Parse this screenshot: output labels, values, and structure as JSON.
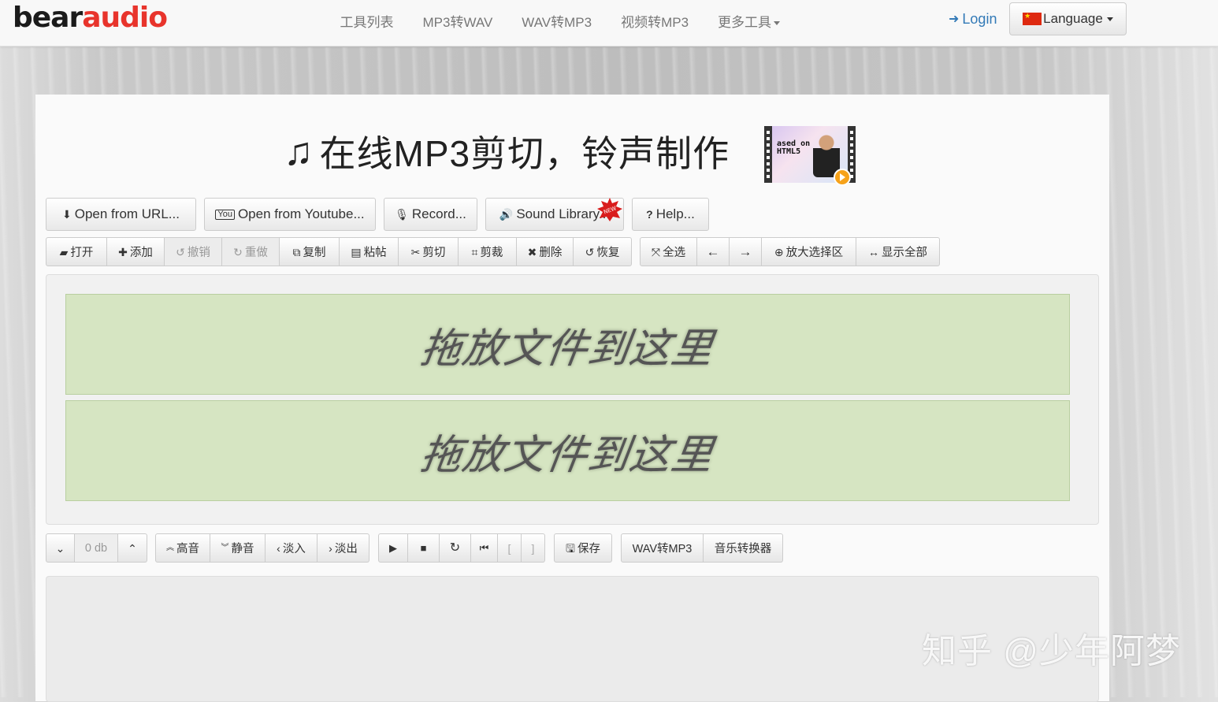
{
  "brand": {
    "part1": "bear",
    "part2": "audio"
  },
  "nav": {
    "items": [
      "工具列表",
      "MP3转WAV",
      "WAV转MP3",
      "视频转MP3",
      "更多工具"
    ],
    "login": "Login",
    "language": "Language"
  },
  "title": "在线MP3剪切，铃声制作",
  "video_thumb_text": "ased on\nHTML5",
  "toolbar1": [
    {
      "label": "Open from URL...",
      "icon": "download-icon"
    },
    {
      "label": "Open from Youtube...",
      "icon": "youtube-icon"
    },
    {
      "label": "Record...",
      "icon": "microphone-icon"
    },
    {
      "label": "Sound Library...",
      "icon": "volume-icon"
    },
    {
      "label": "Help...",
      "icon": "question-icon"
    }
  ],
  "toolbar2": {
    "edit": [
      {
        "label": "打开",
        "icon": "folder-open-icon",
        "glyph": "▰"
      },
      {
        "label": "添加",
        "icon": "plus-icon",
        "glyph": "✚"
      },
      {
        "label": "撤销",
        "icon": "undo-icon",
        "glyph": "↺",
        "disabled": true
      },
      {
        "label": "重做",
        "icon": "redo-icon",
        "glyph": "↻",
        "disabled": true
      },
      {
        "label": "复制",
        "icon": "copy-icon",
        "glyph": "⧉"
      },
      {
        "label": "粘帖",
        "icon": "paste-icon",
        "glyph": "▤"
      },
      {
        "label": "剪切",
        "icon": "scissors-icon",
        "glyph": "✂"
      },
      {
        "label": "剪裁",
        "icon": "crop-icon",
        "glyph": "⌗"
      },
      {
        "label": "删除",
        "icon": "delete-icon",
        "glyph": "✖"
      },
      {
        "label": "恢复",
        "icon": "restore-icon",
        "glyph": "↺"
      }
    ],
    "select": [
      {
        "label": "全选",
        "icon": "fullscreen-icon",
        "glyph": "⤧"
      },
      {
        "label": "",
        "icon": "arrow-left-icon",
        "glyph": "←"
      },
      {
        "label": "",
        "icon": "arrow-right-icon",
        "glyph": "→"
      },
      {
        "label": "放大选择区",
        "icon": "zoom-in-icon",
        "glyph": "⊕"
      },
      {
        "label": "显示全部",
        "icon": "resize-horizontal-icon",
        "glyph": "↔"
      }
    ]
  },
  "drop_zone_text": "拖放文件到这里",
  "volume": {
    "value": "0 db"
  },
  "effects": [
    {
      "label": "高音",
      "glyph": "︽"
    },
    {
      "label": "静音",
      "glyph": "︾"
    },
    {
      "label": "淡入",
      "glyph": "‹"
    },
    {
      "label": "淡出",
      "glyph": "›"
    }
  ],
  "playback": [
    "▶",
    "■",
    "↻",
    "⏮",
    "[",
    "]"
  ],
  "save": "保存",
  "converters": [
    "WAV转MP3",
    "音乐转换器"
  ],
  "watermark": "知乎 @少年阿梦",
  "colors": {
    "accent": "#337ab7",
    "brand_red": "#e8342c",
    "drop_zone": "#d6e5c2"
  }
}
